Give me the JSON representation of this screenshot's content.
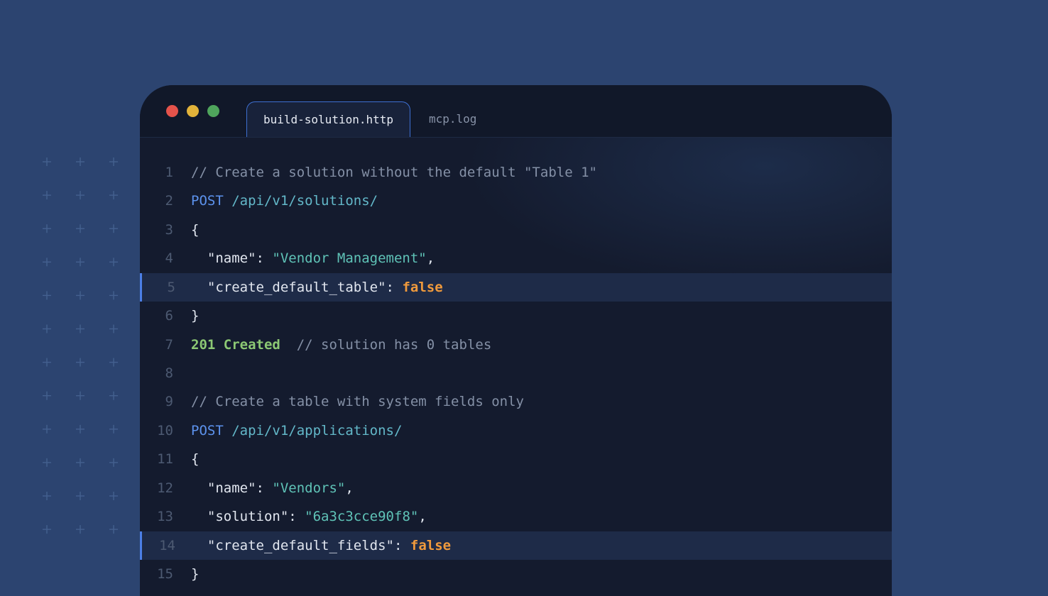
{
  "colors": {
    "page_background": "#2c4470",
    "window_background": "#141b2e",
    "accent": "#4c7fe6",
    "close_dot": "#e5534b",
    "minimize_dot": "#e3b33a",
    "maximize_dot": "#4fa55c"
  },
  "tabs": [
    {
      "label": "build-solution.http",
      "active": true
    },
    {
      "label": "mcp.log",
      "active": false
    }
  ],
  "code": {
    "lines": [
      {
        "number": "1",
        "parts": [
          {
            "t": "// Create a solution without the default \"Table 1\"",
            "c": "comment"
          }
        ]
      },
      {
        "number": "2",
        "parts": [
          {
            "t": "POST",
            "c": "method"
          },
          {
            "t": " /api/v1/solutions/",
            "c": "path"
          }
        ]
      },
      {
        "number": "3",
        "parts": [
          {
            "t": "{",
            "c": "punct"
          }
        ]
      },
      {
        "number": "4",
        "parts": [
          {
            "t": "  \"name\"",
            "c": "key"
          },
          {
            "t": ": ",
            "c": "punct"
          },
          {
            "t": "\"Vendor Management\"",
            "c": "string"
          },
          {
            "t": ",",
            "c": "punct"
          }
        ]
      },
      {
        "number": "5",
        "highlight": true,
        "parts": [
          {
            "t": "  \"create_default_table\"",
            "c": "key"
          },
          {
            "t": ": ",
            "c": "punct"
          },
          {
            "t": "false",
            "c": "bool"
          }
        ]
      },
      {
        "number": "6",
        "parts": [
          {
            "t": "}",
            "c": "punct"
          }
        ]
      },
      {
        "number": "7",
        "parts": [
          {
            "t": "201 Created",
            "c": "status"
          },
          {
            "t": "  // solution has 0 tables",
            "c": "comment"
          }
        ]
      },
      {
        "number": "8",
        "parts": []
      },
      {
        "number": "9",
        "parts": [
          {
            "t": "// Create a table with system fields only",
            "c": "comment"
          }
        ]
      },
      {
        "number": "10",
        "parts": [
          {
            "t": "POST",
            "c": "method"
          },
          {
            "t": " /api/v1/applications/",
            "c": "path"
          }
        ]
      },
      {
        "number": "11",
        "parts": [
          {
            "t": "{",
            "c": "punct"
          }
        ]
      },
      {
        "number": "12",
        "parts": [
          {
            "t": "  \"name\"",
            "c": "key"
          },
          {
            "t": ": ",
            "c": "punct"
          },
          {
            "t": "\"Vendors\"",
            "c": "string"
          },
          {
            "t": ",",
            "c": "punct"
          }
        ]
      },
      {
        "number": "13",
        "parts": [
          {
            "t": "  \"solution\"",
            "c": "key"
          },
          {
            "t": ": ",
            "c": "punct"
          },
          {
            "t": "\"6a3c3cce90f8\"",
            "c": "string"
          },
          {
            "t": ",",
            "c": "punct"
          }
        ]
      },
      {
        "number": "14",
        "highlight": true,
        "parts": [
          {
            "t": "  \"create_default_fields\"",
            "c": "key"
          },
          {
            "t": ": ",
            "c": "punct"
          },
          {
            "t": "false",
            "c": "bool"
          }
        ]
      },
      {
        "number": "15",
        "parts": [
          {
            "t": "}",
            "c": "punct"
          }
        ]
      }
    ]
  }
}
